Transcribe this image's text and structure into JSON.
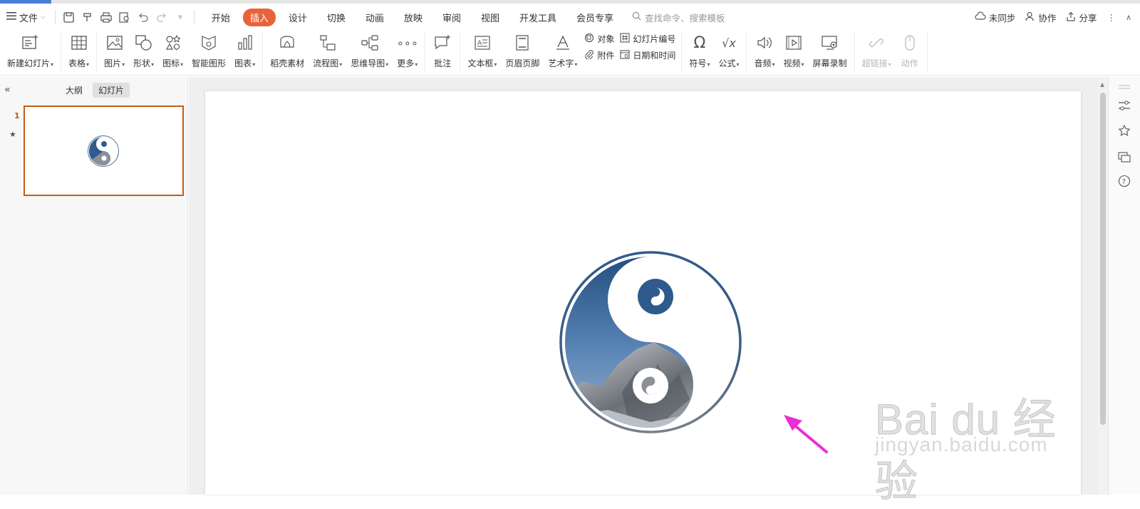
{
  "menubar": {
    "file_label": "文件",
    "tabs": [
      {
        "label": "开始",
        "active": false
      },
      {
        "label": "插入",
        "active": true
      },
      {
        "label": "设计",
        "active": false
      },
      {
        "label": "切换",
        "active": false
      },
      {
        "label": "动画",
        "active": false
      },
      {
        "label": "放映",
        "active": false
      },
      {
        "label": "审阅",
        "active": false
      },
      {
        "label": "视图",
        "active": false
      },
      {
        "label": "开发工具",
        "active": false
      },
      {
        "label": "会员专享",
        "active": false
      }
    ],
    "search_placeholder": "查找命令、搜索模板",
    "sync_label": "未同步",
    "collab_label": "协作",
    "share_label": "分享"
  },
  "ribbon": {
    "new_slide": "新建幻灯片",
    "table": "表格",
    "picture": "图片",
    "shape": "形状",
    "icon": "图标",
    "smartart": "智能图形",
    "chart": "图表",
    "docer_material": "稻壳素材",
    "flowchart": "流程图",
    "mindmap": "思维导图",
    "more": "更多",
    "comment": "批注",
    "textbox": "文本框",
    "header_footer": "页眉页脚",
    "wordart": "艺术字",
    "object": "对象",
    "attachment": "附件",
    "slide_number": "幻灯片编号",
    "date_time": "日期和时间",
    "symbol": "符号",
    "formula": "公式",
    "audio": "音频",
    "video": "视频",
    "screen_record": "屏幕录制",
    "hyperlink": "超链接",
    "action": "动作"
  },
  "panel": {
    "outline_tab": "大纲",
    "slides_tab": "幻灯片",
    "slide_number": "1"
  },
  "watermark": {
    "brand": "Bai du 经验",
    "url": "jingyan.baidu.com"
  },
  "colors": {
    "accent_tab": "#e8633a",
    "thumb_border": "#c55a11",
    "arrow": "#e82ed6",
    "yin": "#2f5b8c"
  }
}
